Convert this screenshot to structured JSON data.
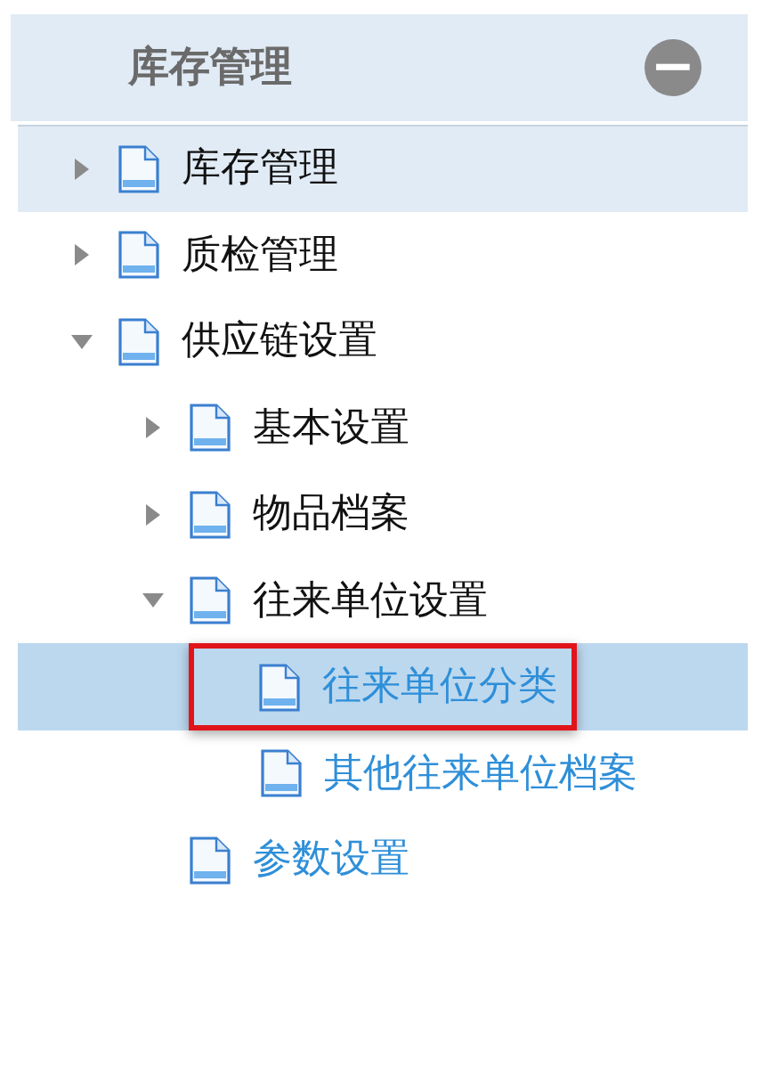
{
  "panel": {
    "title": "库存管理",
    "collapse_icon": "−"
  },
  "tree": [
    {
      "label": "库存管理",
      "kind": "folder",
      "expanded": false,
      "hovered": true,
      "selected": false,
      "highlighted": false
    },
    {
      "label": "质检管理",
      "kind": "folder",
      "expanded": false,
      "hovered": false,
      "selected": false,
      "highlighted": false
    },
    {
      "label": "供应链设置",
      "kind": "folder",
      "expanded": true,
      "hovered": false,
      "selected": false,
      "highlighted": false,
      "children": [
        {
          "label": "基本设置",
          "kind": "folder",
          "expanded": false,
          "hovered": false,
          "selected": false,
          "highlighted": false
        },
        {
          "label": "物品档案",
          "kind": "folder",
          "expanded": false,
          "hovered": false,
          "selected": false,
          "highlighted": false
        },
        {
          "label": "往来单位设置",
          "kind": "folder",
          "expanded": true,
          "hovered": false,
          "selected": false,
          "highlighted": false,
          "children": [
            {
              "label": "往来单位分类",
              "kind": "leaf",
              "hovered": false,
              "selected": true,
              "highlighted": true
            },
            {
              "label": "其他往来单位档案",
              "kind": "leaf",
              "hovered": false,
              "selected": false,
              "highlighted": false
            }
          ]
        },
        {
          "label": "参数设置",
          "kind": "leaf",
          "hovered": false,
          "selected": false,
          "highlighted": false
        }
      ]
    }
  ]
}
